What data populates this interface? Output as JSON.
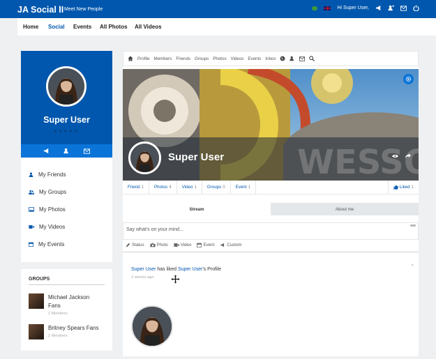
{
  "topbar": {
    "brand": "JA Social II",
    "tagline": "Meet New People",
    "greeting": "Hi Super User,"
  },
  "nav": {
    "items": [
      "Home",
      "Social",
      "Events",
      "All Photos",
      "All Videos"
    ]
  },
  "profile": {
    "name": "Super User",
    "menu": [
      "My Friends",
      "My Groups",
      "My Photos",
      "My Videos",
      "My Events"
    ]
  },
  "groups": {
    "title": "GROUPS",
    "items": [
      {
        "name": "Michael Jackson Fans",
        "members": "2 Members"
      },
      {
        "name": "Britney Spears Fans",
        "members": "2 Members"
      }
    ]
  },
  "toolbar": {
    "items": [
      "Profile",
      "Members",
      "Friends",
      "Groups",
      "Photos",
      "Videos",
      "Events",
      "Inbox"
    ]
  },
  "cover": {
    "name": "Super User"
  },
  "stats": [
    {
      "label": "Friend",
      "count": "1"
    },
    {
      "label": "Photos",
      "count": "4"
    },
    {
      "label": "Video",
      "count": "1"
    },
    {
      "label": "Groups",
      "count": "0"
    },
    {
      "label": "Event",
      "count": "1"
    }
  ],
  "liked": {
    "label": "Liked",
    "count": "1"
  },
  "tabs": {
    "stream": "Stream",
    "about": "About me"
  },
  "composer": {
    "placeholder": "Say what's on your mind...",
    "tools": [
      "Status",
      "Photo",
      "Video",
      "Event",
      "Custom"
    ]
  },
  "feed": {
    "actor": "Super User",
    "verb": " has liked ",
    "target": "Super User",
    "suffix": "'s Profile",
    "time": "2 weeks ago"
  },
  "colors": {
    "brand_blue": "#0157ad",
    "accent_blue": "#0a74d9"
  }
}
